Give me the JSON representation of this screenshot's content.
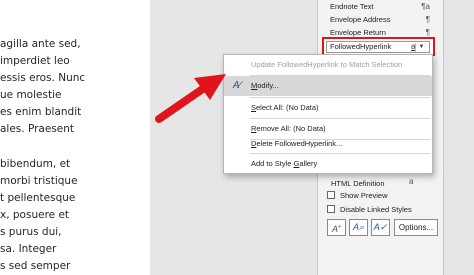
{
  "document": {
    "lines_group1": [
      "agilla ante sed,",
      "imperdiet leo",
      "essis eros. Nunc",
      "ue molestie",
      "es enim blandit",
      "ales. Praesent"
    ],
    "lines_group2": [
      "bibendum, et",
      "morbi tristique",
      "t pellentesque",
      "x, posuere et",
      "s purus dui,",
      "sa. Integer",
      "s sed semper"
    ]
  },
  "styles_pane": {
    "styles": [
      {
        "name": "Endnote Text",
        "glyph": "¶a"
      },
      {
        "name": "Envelope Address",
        "glyph": "¶"
      },
      {
        "name": "Envelope Return",
        "glyph": "¶"
      }
    ],
    "selected_style": {
      "name": "FollowedHyperlink",
      "glyph": "a"
    },
    "html_definition": {
      "name": "HTML Definition",
      "glyph": "a"
    },
    "show_preview": "Show Preview",
    "disable_linked_styles": "Disable Linked Styles",
    "options_button": "Options..."
  },
  "context_menu": {
    "items": [
      {
        "label": "Update FollowedHyperlink to Match Selection",
        "disabled": true
      },
      {
        "label": "Modify...",
        "accelerator": "M",
        "rest": "odify..."
      },
      {
        "label": "Select All: (No Data)",
        "accelerator": "S",
        "rest": "elect All: (No Data)"
      },
      {
        "label": "Remove All: (No Data)",
        "accelerator": "R",
        "rest": "emove All: (No Data)"
      },
      {
        "label": "Delete FollowedHyperlink...",
        "accelerator": "D",
        "rest": "elete FollowedHyperlink..."
      },
      {
        "label": "Add to Style Gallery",
        "accelerator": "G",
        "pre": "Add to Style ",
        "rest": "allery"
      }
    ]
  },
  "colors": {
    "highlight_red": "#e0141a",
    "icon_blue": "#2b5797"
  },
  "icons": {
    "modify": "modify-style-icon",
    "new_style": "new-style-icon",
    "style_inspector": "style-inspector-icon",
    "manage_styles": "manage-styles-icon",
    "arrow": "red-pointer-arrow"
  }
}
